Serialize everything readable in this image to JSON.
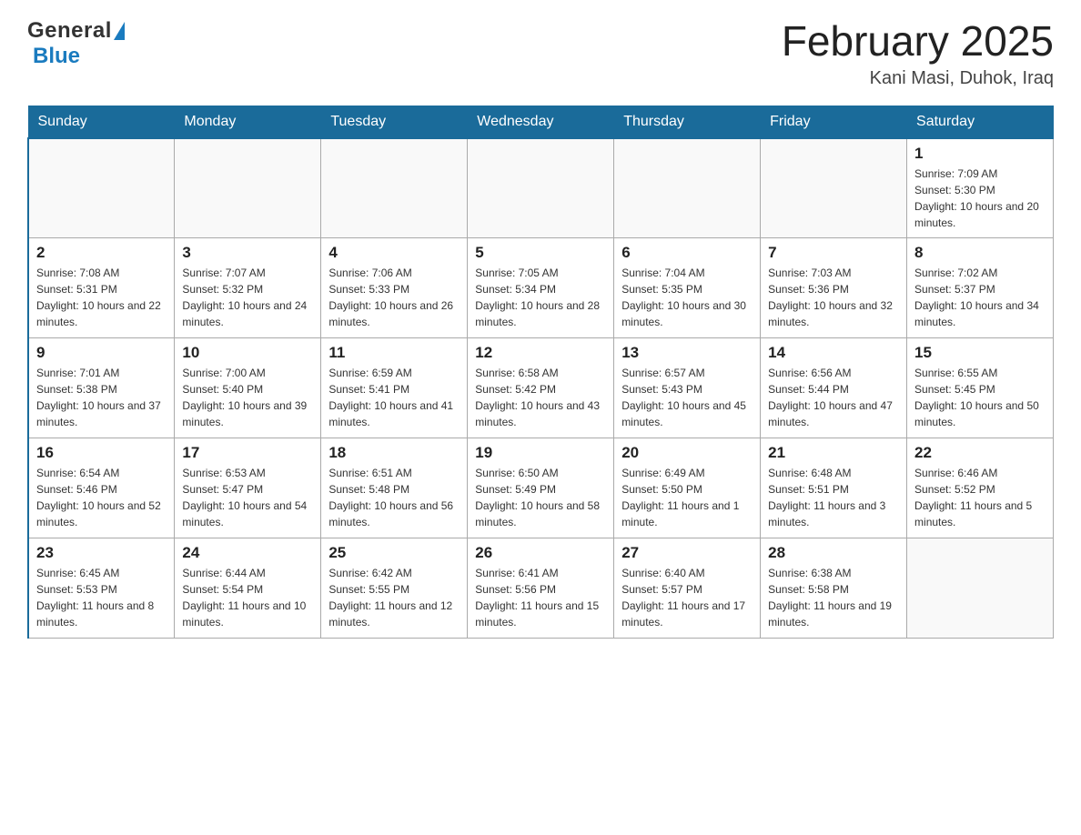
{
  "header": {
    "logo_general": "General",
    "logo_blue": "Blue",
    "month_title": "February 2025",
    "location": "Kani Masi, Duhok, Iraq"
  },
  "weekdays": [
    "Sunday",
    "Monday",
    "Tuesday",
    "Wednesday",
    "Thursday",
    "Friday",
    "Saturday"
  ],
  "weeks": [
    [
      {
        "day": "",
        "info": ""
      },
      {
        "day": "",
        "info": ""
      },
      {
        "day": "",
        "info": ""
      },
      {
        "day": "",
        "info": ""
      },
      {
        "day": "",
        "info": ""
      },
      {
        "day": "",
        "info": ""
      },
      {
        "day": "1",
        "info": "Sunrise: 7:09 AM\nSunset: 5:30 PM\nDaylight: 10 hours and 20 minutes."
      }
    ],
    [
      {
        "day": "2",
        "info": "Sunrise: 7:08 AM\nSunset: 5:31 PM\nDaylight: 10 hours and 22 minutes."
      },
      {
        "day": "3",
        "info": "Sunrise: 7:07 AM\nSunset: 5:32 PM\nDaylight: 10 hours and 24 minutes."
      },
      {
        "day": "4",
        "info": "Sunrise: 7:06 AM\nSunset: 5:33 PM\nDaylight: 10 hours and 26 minutes."
      },
      {
        "day": "5",
        "info": "Sunrise: 7:05 AM\nSunset: 5:34 PM\nDaylight: 10 hours and 28 minutes."
      },
      {
        "day": "6",
        "info": "Sunrise: 7:04 AM\nSunset: 5:35 PM\nDaylight: 10 hours and 30 minutes."
      },
      {
        "day": "7",
        "info": "Sunrise: 7:03 AM\nSunset: 5:36 PM\nDaylight: 10 hours and 32 minutes."
      },
      {
        "day": "8",
        "info": "Sunrise: 7:02 AM\nSunset: 5:37 PM\nDaylight: 10 hours and 34 minutes."
      }
    ],
    [
      {
        "day": "9",
        "info": "Sunrise: 7:01 AM\nSunset: 5:38 PM\nDaylight: 10 hours and 37 minutes."
      },
      {
        "day": "10",
        "info": "Sunrise: 7:00 AM\nSunset: 5:40 PM\nDaylight: 10 hours and 39 minutes."
      },
      {
        "day": "11",
        "info": "Sunrise: 6:59 AM\nSunset: 5:41 PM\nDaylight: 10 hours and 41 minutes."
      },
      {
        "day": "12",
        "info": "Sunrise: 6:58 AM\nSunset: 5:42 PM\nDaylight: 10 hours and 43 minutes."
      },
      {
        "day": "13",
        "info": "Sunrise: 6:57 AM\nSunset: 5:43 PM\nDaylight: 10 hours and 45 minutes."
      },
      {
        "day": "14",
        "info": "Sunrise: 6:56 AM\nSunset: 5:44 PM\nDaylight: 10 hours and 47 minutes."
      },
      {
        "day": "15",
        "info": "Sunrise: 6:55 AM\nSunset: 5:45 PM\nDaylight: 10 hours and 50 minutes."
      }
    ],
    [
      {
        "day": "16",
        "info": "Sunrise: 6:54 AM\nSunset: 5:46 PM\nDaylight: 10 hours and 52 minutes."
      },
      {
        "day": "17",
        "info": "Sunrise: 6:53 AM\nSunset: 5:47 PM\nDaylight: 10 hours and 54 minutes."
      },
      {
        "day": "18",
        "info": "Sunrise: 6:51 AM\nSunset: 5:48 PM\nDaylight: 10 hours and 56 minutes."
      },
      {
        "day": "19",
        "info": "Sunrise: 6:50 AM\nSunset: 5:49 PM\nDaylight: 10 hours and 58 minutes."
      },
      {
        "day": "20",
        "info": "Sunrise: 6:49 AM\nSunset: 5:50 PM\nDaylight: 11 hours and 1 minute."
      },
      {
        "day": "21",
        "info": "Sunrise: 6:48 AM\nSunset: 5:51 PM\nDaylight: 11 hours and 3 minutes."
      },
      {
        "day": "22",
        "info": "Sunrise: 6:46 AM\nSunset: 5:52 PM\nDaylight: 11 hours and 5 minutes."
      }
    ],
    [
      {
        "day": "23",
        "info": "Sunrise: 6:45 AM\nSunset: 5:53 PM\nDaylight: 11 hours and 8 minutes."
      },
      {
        "day": "24",
        "info": "Sunrise: 6:44 AM\nSunset: 5:54 PM\nDaylight: 11 hours and 10 minutes."
      },
      {
        "day": "25",
        "info": "Sunrise: 6:42 AM\nSunset: 5:55 PM\nDaylight: 11 hours and 12 minutes."
      },
      {
        "day": "26",
        "info": "Sunrise: 6:41 AM\nSunset: 5:56 PM\nDaylight: 11 hours and 15 minutes."
      },
      {
        "day": "27",
        "info": "Sunrise: 6:40 AM\nSunset: 5:57 PM\nDaylight: 11 hours and 17 minutes."
      },
      {
        "day": "28",
        "info": "Sunrise: 6:38 AM\nSunset: 5:58 PM\nDaylight: 11 hours and 19 minutes."
      },
      {
        "day": "",
        "info": ""
      }
    ]
  ]
}
